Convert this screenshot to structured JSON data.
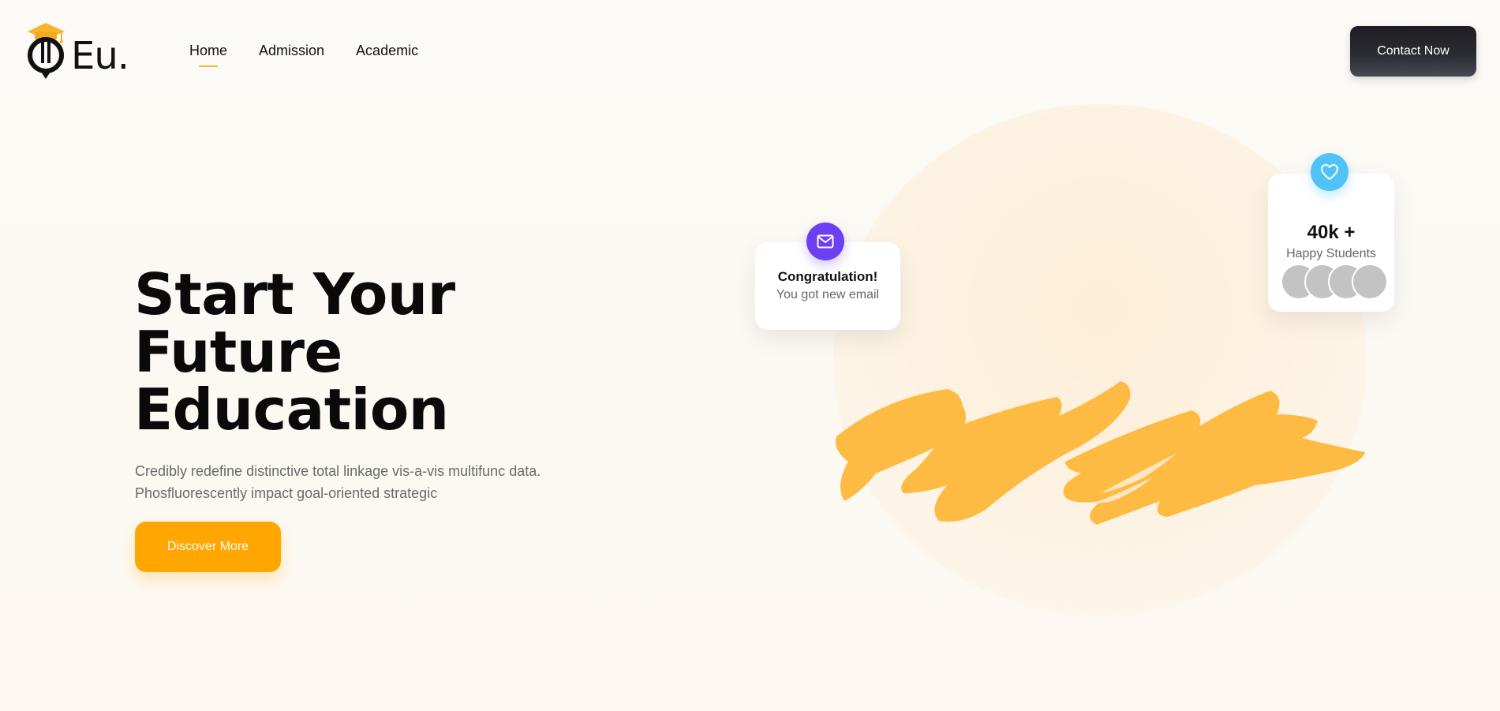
{
  "brand": {
    "name": "Eu.",
    "accent": "#ffa600",
    "cap_color": "#f7b32b"
  },
  "nav": {
    "items": [
      {
        "label": "Home",
        "active": true
      },
      {
        "label": "Admission",
        "active": false
      },
      {
        "label": "Academic",
        "active": false
      }
    ],
    "contact_label": "Contact Now"
  },
  "hero": {
    "title_lines": [
      "Start Your",
      "Future",
      "Education"
    ],
    "description": "Credibly redefine distinctive total linkage vis-a-vis multifunc data. Phosfluorescently impact goal-oriented strategic",
    "cta_label": "Discover More"
  },
  "email_card": {
    "title": "Congratulation!",
    "subtitle": "You got new email",
    "icon": "mail-icon",
    "icon_color": "#6c3ff2"
  },
  "students_card": {
    "count": "40k +",
    "label": "Happy Students",
    "icon": "heart-icon",
    "icon_color": "#4fc3f7",
    "avatar_count": 4
  }
}
